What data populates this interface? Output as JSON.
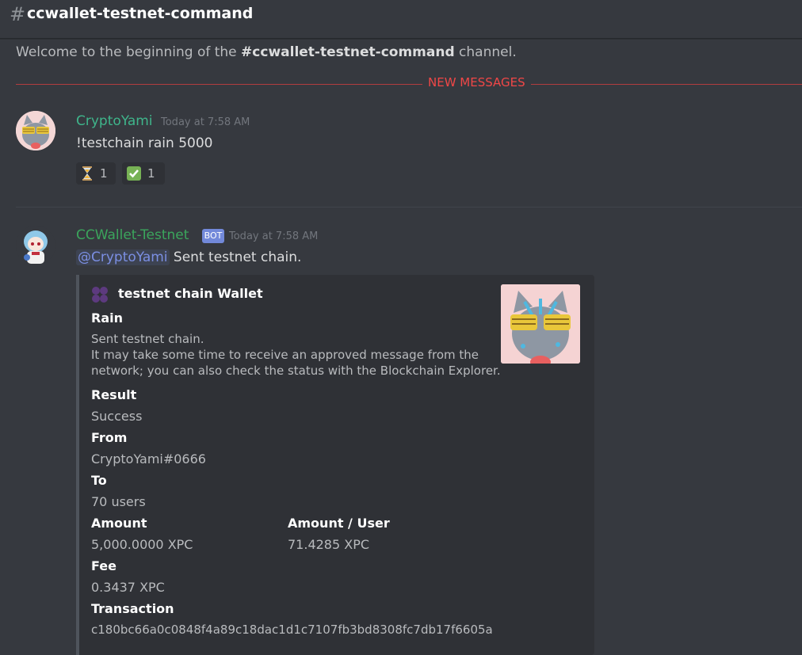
{
  "channel": {
    "hash": "#",
    "name": "ccwallet-testnet-command",
    "welcome_prefix": "Welcome to the beginning of the ",
    "welcome_channel": "#ccwallet-testnet-command",
    "welcome_suffix": " channel."
  },
  "new_messages_label": "NEW MESSAGES",
  "messages": [
    {
      "author": "CryptoYami",
      "timestamp": "Today at 7:58 AM",
      "content": "!testchain rain 5000",
      "reactions": [
        {
          "emoji": "hourglass-icon",
          "count": "1"
        },
        {
          "emoji": "check-icon",
          "count": "1"
        }
      ]
    },
    {
      "author": "CCWallet-Testnet",
      "bot_tag": "BOT",
      "timestamp": "Today at 7:58 AM",
      "mention": "@CryptoYami",
      "content": " Sent testnet chain.",
      "embed": {
        "author": "testnet chain Wallet",
        "title": "Rain",
        "desc_line1": "Sent testnet chain.",
        "desc_line2": "It may take some time to receive an approved message from the",
        "desc_line3": "network; you can also check the status with the Blockchain Explorer.",
        "fields": [
          {
            "name": "Result",
            "value": "Success"
          },
          {
            "name": "From",
            "value": "CryptoYami#0666"
          },
          {
            "name": "To",
            "value": "70 users"
          },
          {
            "name": "Amount",
            "value": "5,000.0000 XPC"
          },
          {
            "name": "Amount / User",
            "value": "71.4285 XPC"
          },
          {
            "name": "Fee",
            "value": "0.3437 XPC"
          },
          {
            "name": "Transaction",
            "value": "c180bc66a0c0848f4a89c18dac1d1c7107fb3bd8308fc7db17f6605a"
          }
        ]
      }
    }
  ],
  "colors": {
    "background": "#36393f",
    "author_user": "#3fb58b",
    "author_bot": "#3ba55c",
    "new_messages": "#f04747",
    "mention": "#7b8fe3"
  }
}
